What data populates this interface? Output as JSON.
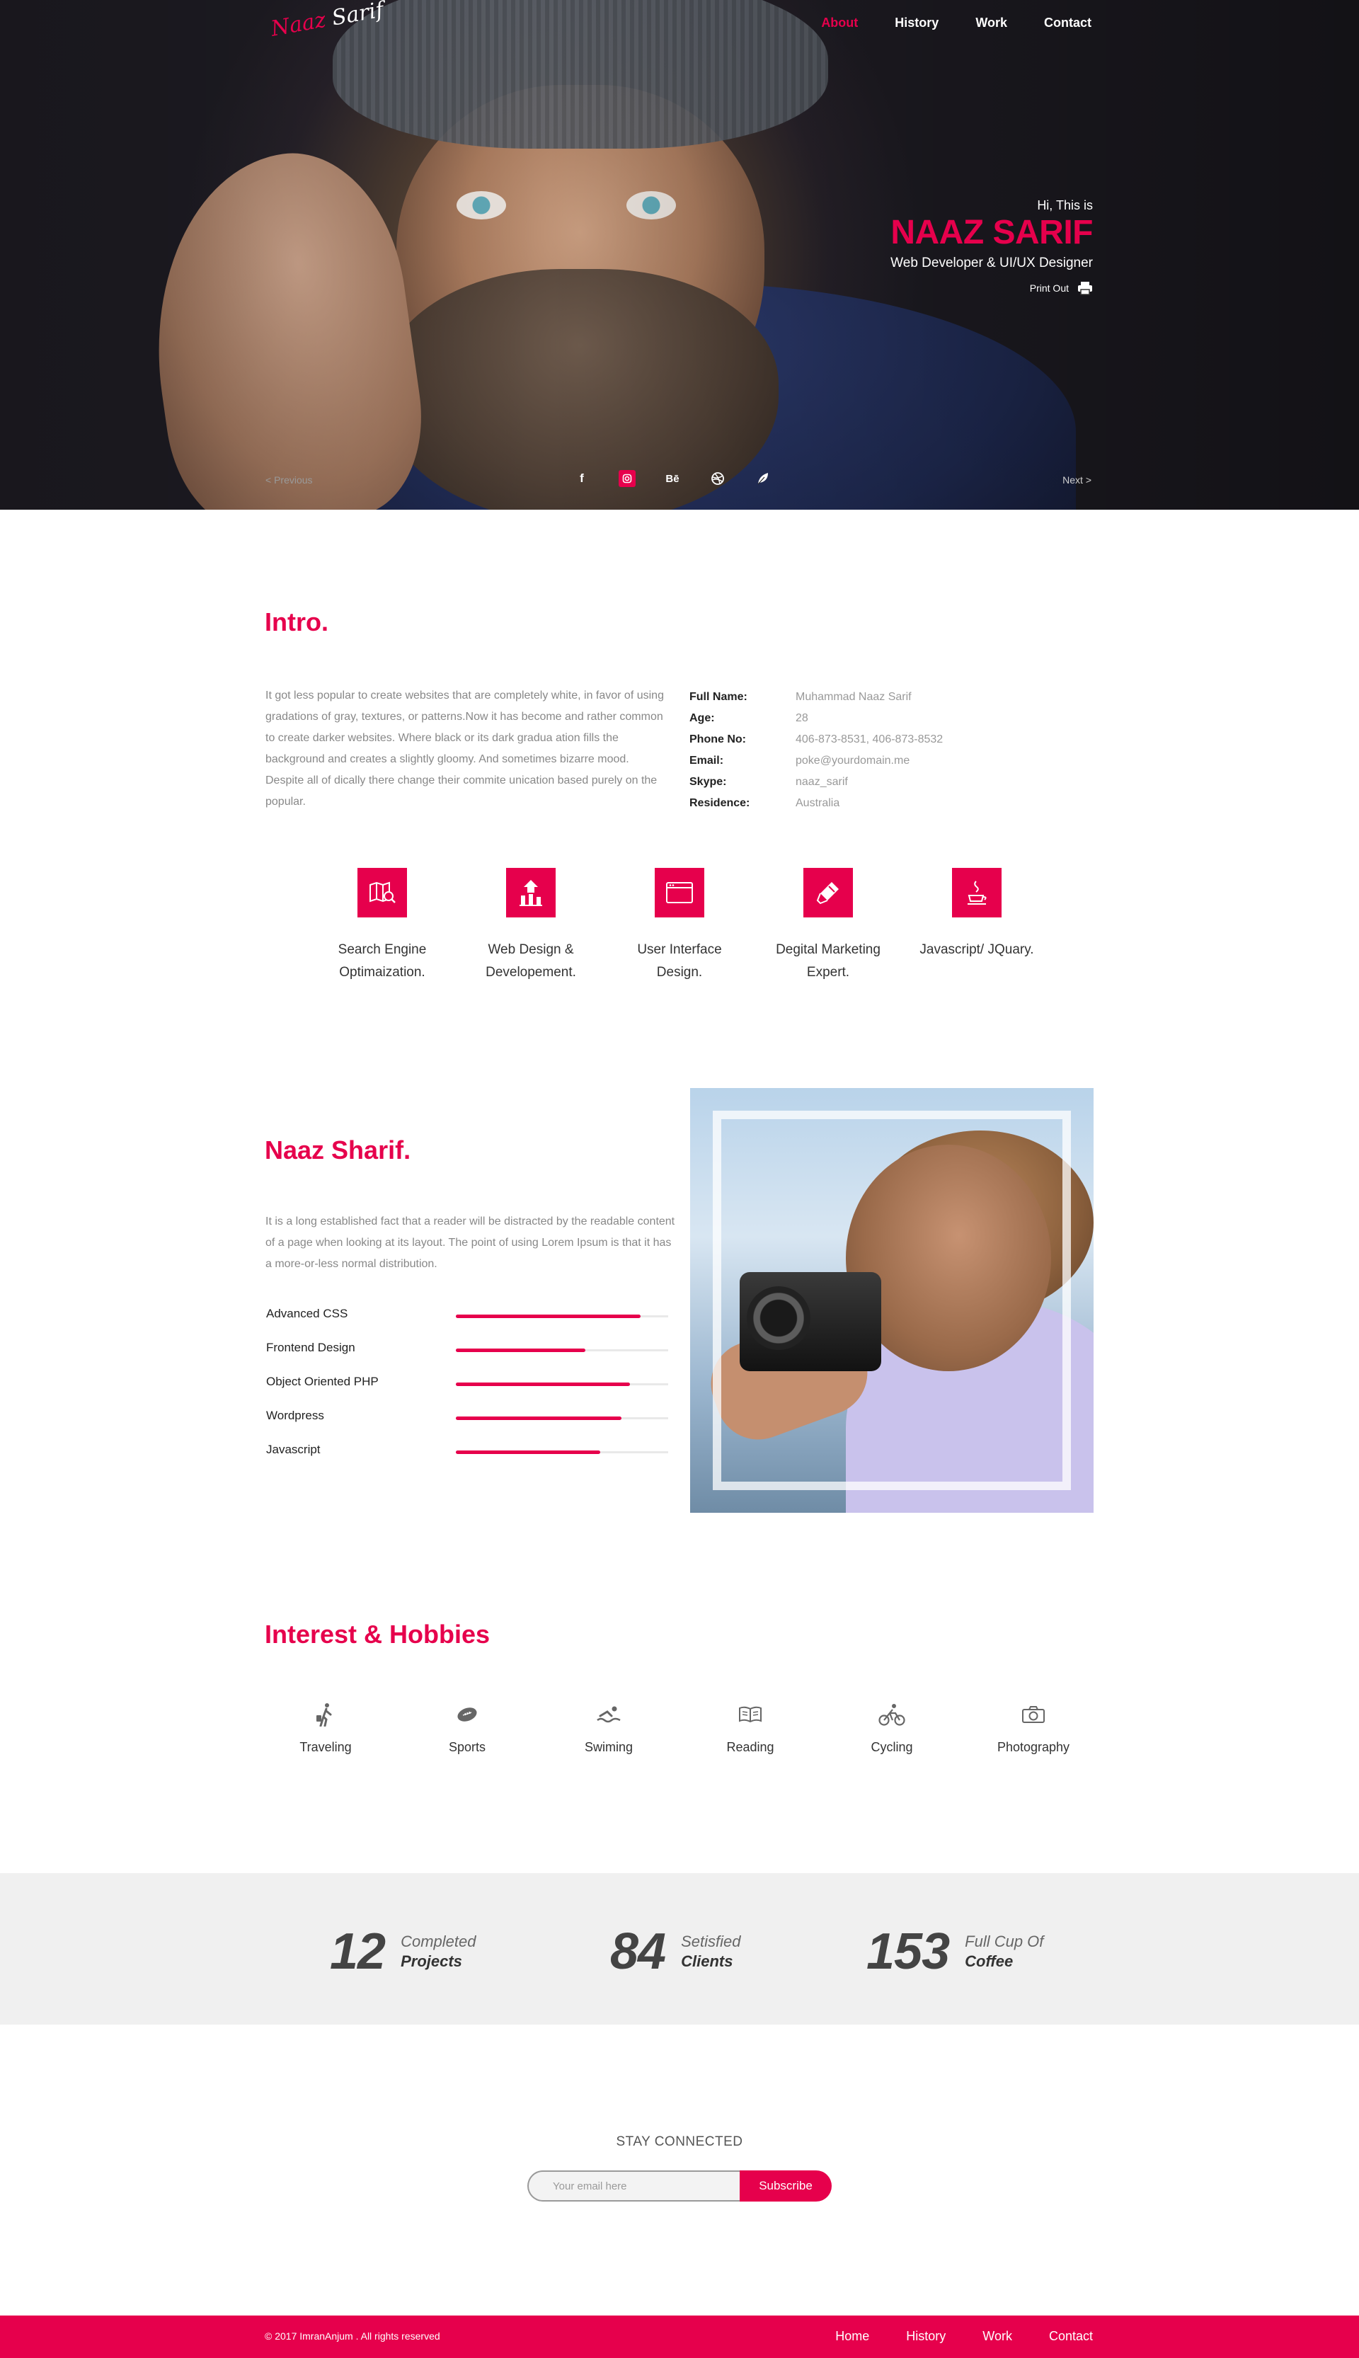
{
  "brand": {
    "logo_line1": "Naaz",
    "logo_line2": "Sarif"
  },
  "nav": [
    {
      "label": "About",
      "active": true
    },
    {
      "label": "History",
      "active": false
    },
    {
      "label": "Work",
      "active": false
    },
    {
      "label": "Contact",
      "active": false
    }
  ],
  "hero": {
    "greeting": "Hi, This is",
    "name": "NAAZ SARIF",
    "role": "Web Developer & UI/UX Designer",
    "print_label": "Print Out",
    "prev_label": "< Previous",
    "next_label": "Next >",
    "socials": [
      "facebook-icon",
      "instagram-icon",
      "behance-icon",
      "dribbble-icon",
      "leaf-icon"
    ],
    "behance_text": "Bē",
    "facebook_text": "f"
  },
  "intro": {
    "title": "Intro.",
    "paragraph": "It got less popular to create websites that are completely white, in favor of using gradations of gray, textures, or patterns.Now it has become and rather common to create darker websites. Where black or its dark gradua ation fills the background and creates a slightly gloomy. And sometimes bizarre mood. Despite all of dically there change their commite unication based purely on the popular.",
    "info": [
      {
        "key": "Full Name:",
        "value": "Muhammad Naaz Sarif"
      },
      {
        "key": "Age:",
        "value": "28"
      },
      {
        "key": "Phone No:",
        "value": "406-873-8531, 406-873-8532"
      },
      {
        "key": "Email:",
        "value": "poke@yourdomain.me"
      },
      {
        "key": "Skype:",
        "value": "naaz_sarif"
      },
      {
        "key": "Residence:",
        "value": "Australia"
      }
    ],
    "services": [
      {
        "icon": "search-map-icon",
        "line1": "Search Engine",
        "line2": "Optimaization."
      },
      {
        "icon": "growth-chart-icon",
        "line1": "Web Design &",
        "line2": "Developement."
      },
      {
        "icon": "browser-window-icon",
        "line1": "User Interface",
        "line2": "Design."
      },
      {
        "icon": "marker-icon",
        "line1": "Degital Marketing",
        "line2": "Expert."
      },
      {
        "icon": "java-cup-icon",
        "line1": "Javascript/ JQuary.",
        "line2": ""
      }
    ]
  },
  "about": {
    "title": "Naaz Sharif.",
    "paragraph": "It is a long established fact that a reader will be distracted by the readable content of a page when looking at its layout. The point of using Lorem Ipsum is that it has a more-or-less normal distribution.",
    "skills": [
      {
        "name": "Advanced CSS",
        "level": 0.87
      },
      {
        "name": "Frontend Design",
        "level": 0.61
      },
      {
        "name": "Object Oriented PHP",
        "level": 0.82
      },
      {
        "name": "Wordpress",
        "level": 0.78
      },
      {
        "name": "Javascript",
        "level": 0.68
      }
    ]
  },
  "hobbies": {
    "title": "Interest & Hobbies",
    "items": [
      {
        "icon": "traveler-icon",
        "label": "Traveling"
      },
      {
        "icon": "football-icon",
        "label": "Sports"
      },
      {
        "icon": "swimmer-icon",
        "label": "Swiming"
      },
      {
        "icon": "book-icon",
        "label": "Reading"
      },
      {
        "icon": "cyclist-icon",
        "label": "Cycling"
      },
      {
        "icon": "camera-icon",
        "label": "Photography"
      }
    ]
  },
  "counters": [
    {
      "number": "12",
      "line1": "Completed",
      "line2": "Projects"
    },
    {
      "number": "84",
      "line1": "Setisfied",
      "line2": "Clients"
    },
    {
      "number": "153",
      "line1": "Full Cup Of",
      "line2": "Coffee"
    }
  ],
  "subscribe": {
    "heading": "STAY CONNECTED",
    "placeholder": "Your email here",
    "button_label": "Subscribe"
  },
  "footer": {
    "copyright": "© 2017 ImranAnjum . All rights reserved",
    "nav": [
      "Home",
      "History",
      "Work",
      "Contact"
    ]
  },
  "colors": {
    "accent": "#e6004c",
    "text_dark": "#333333",
    "muted": "#888888",
    "band": "#f0f0f0"
  }
}
